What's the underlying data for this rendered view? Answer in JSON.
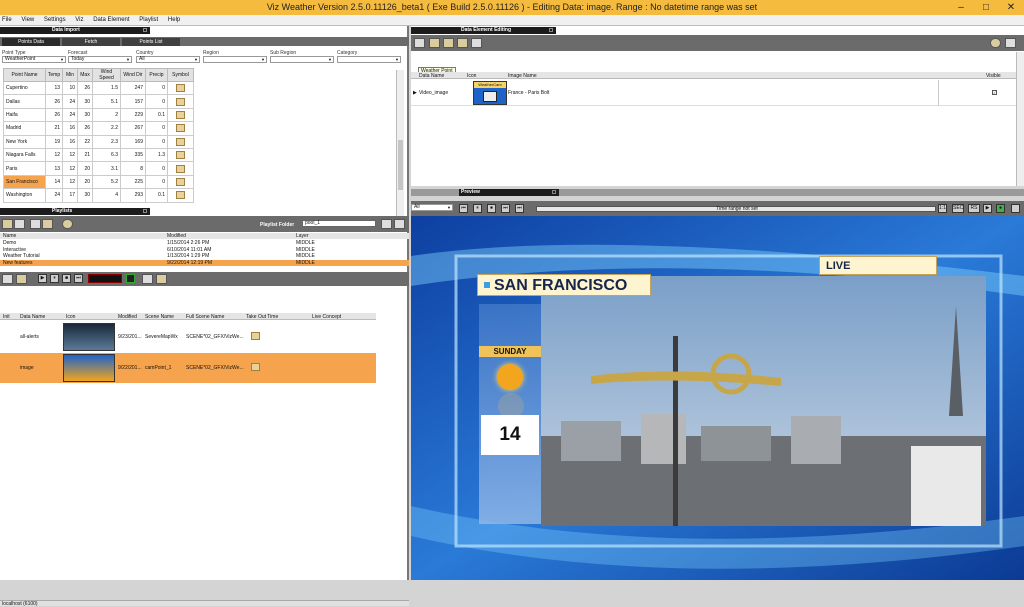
{
  "window": {
    "title": "Viz Weather Version 2.5.0.11126_beta1 ( Exe Build 2.5.0.11126 )  -  Editing Data: image. Range : No datetime range was set",
    "controls": [
      "–",
      "□",
      "✕"
    ]
  },
  "menu": [
    "File",
    "View",
    "Settings",
    "Viz",
    "Data Element",
    "Playlist",
    "Help"
  ],
  "data_import": {
    "header": "Data Import",
    "tabs": [
      "Points Data",
      "Fetch",
      "Points List"
    ],
    "filters": [
      {
        "label": "Point Type",
        "value": "WeatherPoint"
      },
      {
        "label": "Forecast",
        "value": "Today"
      },
      {
        "label": "Country",
        "value": "All"
      },
      {
        "label": "Region",
        "value": ""
      },
      {
        "label": "Sub Region",
        "value": ""
      },
      {
        "label": "Category",
        "value": ""
      }
    ],
    "columns": [
      "Point Name",
      "Temp",
      "Min",
      "Max",
      "Wind Speed",
      "Wind Dir",
      "Precip",
      "Symbol"
    ],
    "rows": [
      [
        "Cupertino",
        "13",
        "10",
        "26",
        "1.5",
        "247",
        "0"
      ],
      [
        "Dallas",
        "26",
        "24",
        "30",
        "5.1",
        "157",
        "0"
      ],
      [
        "Haifa",
        "26",
        "24",
        "30",
        "2",
        "229",
        "0.1"
      ],
      [
        "Madrid",
        "21",
        "16",
        "26",
        "2.2",
        "267",
        "0"
      ],
      [
        "New York",
        "19",
        "16",
        "22",
        "2.3",
        "169",
        "0"
      ],
      [
        "Niagara Falls",
        "12",
        "12",
        "21",
        "6.3",
        "335",
        "1.3"
      ],
      [
        "Paris",
        "13",
        "12",
        "20",
        "3.1",
        "8",
        "0"
      ],
      [
        "San Francisco",
        "14",
        "12",
        "20",
        "5.2",
        "225",
        "0"
      ],
      [
        "Washington",
        "24",
        "17",
        "30",
        "4",
        "293",
        "0.1"
      ]
    ],
    "selected_row": 7
  },
  "playlists": {
    "header": "Playlists",
    "folder_label": "Playlist Folder",
    "folder_value": "pool_1",
    "columns": [
      "Name",
      "Modified",
      "Layer"
    ],
    "rows": [
      [
        "Demo",
        "1/15/2014 2:26 PM",
        "MIDDLE"
      ],
      [
        "Interactive",
        "6/10/2014 11:01 AM",
        "MIDDLE"
      ],
      [
        "Weather Tutorial",
        "1/13/2014 1:29 PM",
        "MIDDLE"
      ],
      [
        "New features",
        "9/22/2014 12:19 PM",
        "MIDDLE"
      ]
    ],
    "selected_row": 3
  },
  "data_elements": {
    "columns": [
      "Init",
      "Data Name",
      "Icon",
      "Modified",
      "Scene Name",
      "Full Scene Name",
      "Take Out Time",
      "Live Concept"
    ],
    "rows": [
      {
        "name": "all-alerts",
        "modified": "9/23/201...",
        "scene": "SevereMapWx",
        "full": "SCENE*02_GFX/VizWe..."
      },
      {
        "name": "image",
        "modified": "9/22/201...",
        "scene": "camPoint_1",
        "full": "SCENE*02_GFX/VizWe..."
      }
    ],
    "selected_row": 1
  },
  "status": "localhost (6100)",
  "editing": {
    "header": "Data Element Editing",
    "tooltip": "Weather Point",
    "columns": [
      "Data Name",
      "Icon",
      "Image Name",
      "Visible"
    ],
    "row": {
      "name": "Video_image",
      "icon_label": "WeatherCam",
      "image": "France - Paris Bolt",
      "visible": "✓"
    }
  },
  "preview": {
    "header": "Preview",
    "select_value": "All",
    "timeline_text": "Time range not set",
    "buttons": [
      "⏮",
      "⏸",
      "⏹",
      "⏭",
      "⏭"
    ],
    "right_buttons": [
      "1:1",
      "SEC",
      "RS",
      "▶",
      "●"
    ],
    "city": "SAN FRANCISCO",
    "live": "LIVE",
    "day": "SUNDAY",
    "temp": "14"
  },
  "colors": {
    "titlebar": "#f5bb3e",
    "selection": "#f6a34d",
    "preview_bg": "#1a4fa8"
  }
}
